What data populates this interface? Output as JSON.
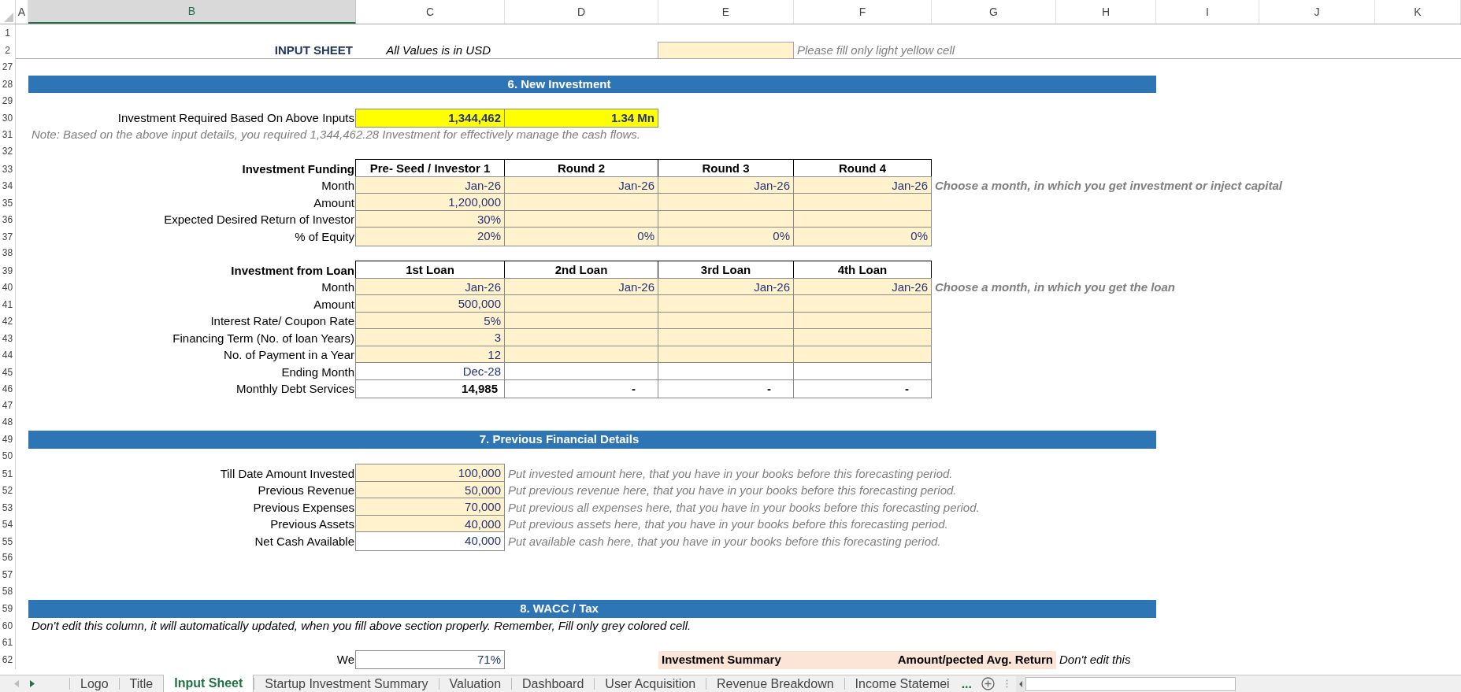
{
  "columns": [
    {
      "label": "A",
      "selected": false
    },
    {
      "label": "B",
      "selected": true
    },
    {
      "label": "C",
      "selected": false
    },
    {
      "label": "D",
      "selected": false
    },
    {
      "label": "E",
      "selected": false
    },
    {
      "label": "F",
      "selected": false
    },
    {
      "label": "G",
      "selected": false
    },
    {
      "label": "H",
      "selected": false
    },
    {
      "label": "I",
      "selected": false
    },
    {
      "label": "J",
      "selected": false
    },
    {
      "label": "K",
      "selected": false
    }
  ],
  "rows": [
    {
      "number": "1",
      "kind": "plain"
    },
    {
      "number": "2",
      "kind": "ruled",
      "cells": [
        {
          "kind": "blank"
        },
        {
          "kind": "title",
          "text": "INPUT SHEET"
        },
        {
          "kind": "caption",
          "text": "All Values is in USD"
        },
        {
          "kind": "blank"
        },
        {
          "kind": "swatch"
        },
        {
          "kind": "note",
          "text": "Please fill only light yellow cell"
        }
      ]
    },
    {
      "number": "27",
      "kind": "plain"
    },
    {
      "number": "28",
      "kind": "plain",
      "cells": [
        {
          "kind": "blank"
        },
        {
          "kind": "banner",
          "text": "6. New Investment"
        }
      ]
    },
    {
      "number": "29",
      "kind": "plain"
    },
    {
      "number": "30",
      "kind": "plain",
      "cells": [
        {
          "kind": "blank"
        },
        {
          "kind": "label",
          "text": "Investment Required Based On Above Inputs"
        },
        {
          "kind": "highlight",
          "text": "1,344,462"
        },
        {
          "kind": "highlight",
          "text": "1.34 Mn"
        }
      ]
    },
    {
      "number": "31",
      "kind": "plain",
      "cells": [
        {
          "kind": "blank"
        },
        {
          "kind": "note",
          "text": "Note: Based on the above input details, you required 1,344,462.28 Investment for effectively manage the cash flows."
        }
      ]
    },
    {
      "number": "32",
      "kind": "plain"
    },
    {
      "number": "33",
      "kind": "plain",
      "cells": [
        {
          "kind": "blank"
        },
        {
          "kind": "label-bold",
          "text": "Investment Funding"
        },
        {
          "kind": "header",
          "text": "Pre- Seed / Investor 1"
        },
        {
          "kind": "header",
          "text": "Round 2"
        },
        {
          "kind": "header",
          "text": "Round 3"
        },
        {
          "kind": "header",
          "text": "Round 4"
        }
      ]
    },
    {
      "number": "34",
      "kind": "plain",
      "cells": [
        {
          "kind": "blank"
        },
        {
          "kind": "label",
          "text": "Month"
        },
        {
          "kind": "input",
          "text": "Jan-26"
        },
        {
          "kind": "input",
          "text": "Jan-26"
        },
        {
          "kind": "input",
          "text": "Jan-26"
        },
        {
          "kind": "input",
          "text": "Jan-26"
        },
        {
          "kind": "note-bold",
          "text": "Choose a month, in which you get investment or inject capital"
        }
      ]
    },
    {
      "number": "35",
      "kind": "plain",
      "cells": [
        {
          "kind": "blank"
        },
        {
          "kind": "label",
          "text": "Amount"
        },
        {
          "kind": "input",
          "text": "1,200,000"
        },
        {
          "kind": "input"
        },
        {
          "kind": "input"
        },
        {
          "kind": "input"
        }
      ]
    },
    {
      "number": "36",
      "kind": "plain",
      "cells": [
        {
          "kind": "blank"
        },
        {
          "kind": "label",
          "text": "Expected Desired Return of Investor"
        },
        {
          "kind": "input",
          "text": "30%"
        },
        {
          "kind": "input"
        },
        {
          "kind": "input"
        },
        {
          "kind": "input"
        }
      ]
    },
    {
      "number": "37",
      "kind": "plain",
      "cells": [
        {
          "kind": "blank"
        },
        {
          "kind": "label",
          "text": "% of Equity"
        },
        {
          "kind": "input",
          "text": "20%"
        },
        {
          "kind": "input",
          "text": "0%"
        },
        {
          "kind": "input",
          "text": "0%"
        },
        {
          "kind": "input",
          "text": "0%"
        }
      ]
    },
    {
      "number": "38",
      "kind": "plain"
    },
    {
      "number": "39",
      "kind": "plain",
      "cells": [
        {
          "kind": "blank"
        },
        {
          "kind": "label-bold",
          "text": "Investment from Loan"
        },
        {
          "kind": "header",
          "text": "1st Loan"
        },
        {
          "kind": "header",
          "text": "2nd Loan"
        },
        {
          "kind": "header",
          "text": "3rd Loan"
        },
        {
          "kind": "header",
          "text": "4th Loan"
        }
      ]
    },
    {
      "number": "40",
      "kind": "plain",
      "cells": [
        {
          "kind": "blank"
        },
        {
          "kind": "label",
          "text": "Month"
        },
        {
          "kind": "input",
          "text": "Jan-26"
        },
        {
          "kind": "input",
          "text": "Jan-26"
        },
        {
          "kind": "input",
          "text": "Jan-26"
        },
        {
          "kind": "input",
          "text": "Jan-26"
        },
        {
          "kind": "note-bold",
          "text": "Choose a month, in which you get the loan"
        }
      ]
    },
    {
      "number": "41",
      "kind": "plain",
      "cells": [
        {
          "kind": "blank"
        },
        {
          "kind": "label",
          "text": "Amount"
        },
        {
          "kind": "input",
          "text": "500,000"
        },
        {
          "kind": "input"
        },
        {
          "kind": "input"
        },
        {
          "kind": "input"
        }
      ]
    },
    {
      "number": "42",
      "kind": "plain",
      "cells": [
        {
          "kind": "blank"
        },
        {
          "kind": "label",
          "text": "Interest Rate/ Coupon Rate"
        },
        {
          "kind": "input",
          "text": "5%"
        },
        {
          "kind": "input"
        },
        {
          "kind": "input"
        },
        {
          "kind": "input"
        }
      ]
    },
    {
      "number": "43",
      "kind": "plain",
      "cells": [
        {
          "kind": "blank"
        },
        {
          "kind": "label",
          "text": "Financing Term (No. of loan Years)"
        },
        {
          "kind": "input",
          "text": "3"
        },
        {
          "kind": "input"
        },
        {
          "kind": "input"
        },
        {
          "kind": "input"
        }
      ]
    },
    {
      "number": "44",
      "kind": "plain",
      "cells": [
        {
          "kind": "blank"
        },
        {
          "kind": "label",
          "text": "No. of Payment in a Year"
        },
        {
          "kind": "input",
          "text": "12"
        },
        {
          "kind": "input"
        },
        {
          "kind": "input"
        },
        {
          "kind": "input"
        }
      ]
    },
    {
      "number": "45",
      "kind": "plain",
      "cells": [
        {
          "kind": "blank"
        },
        {
          "kind": "label",
          "text": "Ending Month"
        },
        {
          "kind": "output",
          "text": "Dec-28"
        },
        {
          "kind": "output"
        },
        {
          "kind": "output"
        },
        {
          "kind": "output"
        }
      ]
    },
    {
      "number": "46",
      "kind": "plain",
      "cells": [
        {
          "kind": "blank"
        },
        {
          "kind": "label",
          "text": "Monthly Debt Services"
        },
        {
          "kind": "output-bold",
          "text": "14,985"
        },
        {
          "kind": "nil",
          "text": "-"
        },
        {
          "kind": "nil",
          "text": "-"
        },
        {
          "kind": "nil",
          "text": "-"
        }
      ]
    },
    {
      "number": "47",
      "kind": "plain"
    },
    {
      "number": "48",
      "kind": "plain"
    },
    {
      "number": "49",
      "kind": "plain",
      "cells": [
        {
          "kind": "blank"
        },
        {
          "kind": "banner",
          "text": "7. Previous Financial Details"
        }
      ]
    },
    {
      "number": "50",
      "kind": "plain"
    },
    {
      "number": "51",
      "kind": "plain",
      "cells": [
        {
          "kind": "blank"
        },
        {
          "kind": "label",
          "text": "Till Date Amount Invested"
        },
        {
          "kind": "input",
          "text": "100,000"
        },
        {
          "kind": "note",
          "text": "Put invested amount here, that you have in your books before this forecasting period."
        }
      ]
    },
    {
      "number": "52",
      "kind": "plain",
      "cells": [
        {
          "kind": "blank"
        },
        {
          "kind": "label",
          "text": "Previous Revenue"
        },
        {
          "kind": "input",
          "text": "50,000"
        },
        {
          "kind": "note",
          "text": "Put previous revenue here, that you have in your books before this forecasting period."
        }
      ]
    },
    {
      "number": "53",
      "kind": "plain",
      "cells": [
        {
          "kind": "blank"
        },
        {
          "kind": "label",
          "text": "Previous Expenses"
        },
        {
          "kind": "input",
          "text": "70,000"
        },
        {
          "kind": "note",
          "text": "Put previous all expenses here, that you have in your books before this forecasting period."
        }
      ]
    },
    {
      "number": "54",
      "kind": "plain",
      "cells": [
        {
          "kind": "blank"
        },
        {
          "kind": "label",
          "text": "Previous Assets"
        },
        {
          "kind": "input",
          "text": "40,000"
        },
        {
          "kind": "note",
          "text": "Put previous assets here, that you have in your books before this forecasting period."
        }
      ]
    },
    {
      "number": "55",
      "kind": "plain",
      "cells": [
        {
          "kind": "blank"
        },
        {
          "kind": "label",
          "text": "Net Cash Available"
        },
        {
          "kind": "output",
          "text": "40,000"
        },
        {
          "kind": "note",
          "text": "Put available cash here, that you have in your books before this forecasting period."
        }
      ]
    },
    {
      "number": "56",
      "kind": "plain"
    },
    {
      "number": "57",
      "kind": "plain"
    },
    {
      "number": "58",
      "kind": "plain"
    },
    {
      "number": "59",
      "kind": "plain",
      "cells": [
        {
          "kind": "blank"
        },
        {
          "kind": "banner",
          "text": "8. WACC / Tax"
        }
      ]
    },
    {
      "number": "60",
      "kind": "plain",
      "cells": [
        {
          "kind": "blank"
        },
        {
          "kind": "note-dark",
          "text": "Don't edit this column, it will automatically updated, when you fill above section properly. Remember, Fill only grey colored cell."
        }
      ]
    },
    {
      "number": "61",
      "kind": "plain"
    },
    {
      "number": "62",
      "kind": "plain",
      "cells": [
        {
          "kind": "blank"
        },
        {
          "kind": "label",
          "text": "We"
        },
        {
          "kind": "output",
          "text": "71%"
        },
        {
          "kind": "blank"
        },
        {
          "kind": "summary-header",
          "text": "Investment Summary"
        },
        {
          "kind": "summary-wide",
          "text": "Amount/pected Avg. Return"
        },
        {
          "kind": "note-dark",
          "text": "Don't edit this"
        }
      ]
    }
  ],
  "sheet_tabs": [
    {
      "label": "Logo",
      "selected": false
    },
    {
      "label": "Title",
      "selected": false
    },
    {
      "label": "Input Sheet",
      "selected": true
    },
    {
      "label": "Startup Investment Summary",
      "selected": false
    },
    {
      "label": "Valuation",
      "selected": false
    },
    {
      "label": "Dashboard",
      "selected": false
    },
    {
      "label": "User Acquisition",
      "selected": false
    },
    {
      "label": "Revenue Breakdown",
      "selected": false
    },
    {
      "label": "Income Statemei",
      "selected": false
    }
  ],
  "more_tabs": "..."
}
